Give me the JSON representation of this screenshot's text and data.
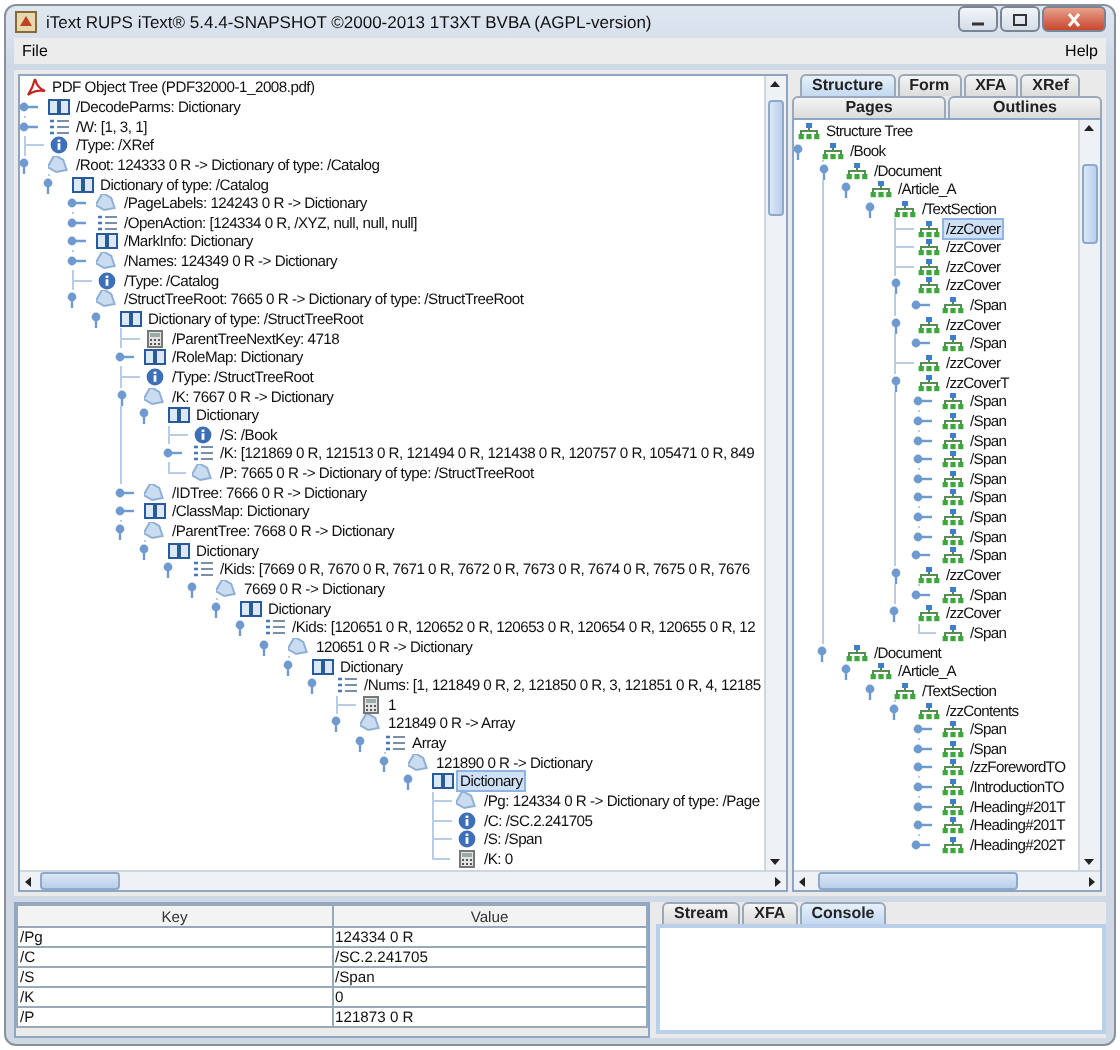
{
  "window": {
    "title": "iText RUPS iText® 5.4.4-SNAPSHOT ©2000-2013 1T3XT BVBA (AGPL-version)"
  },
  "menu": [
    {
      "label": "File"
    },
    {
      "label": "Help"
    }
  ],
  "object_tree": {
    "title": "PDF Object Tree (PDF32000-1_2008.pdf)",
    "children": [
      {
        "label": "/DecodeParms: Dictionary",
        "kind": "dict",
        "expanded": false,
        "selected": false
      },
      {
        "label": "/W: [1, 3, 1]",
        "kind": "array",
        "expanded": false,
        "selected": false
      },
      {
        "label": "/Type: /XRef",
        "kind": "info",
        "selected": false
      },
      {
        "label": "/Root: 124333 0 R -> Dictionary of type: /Catalog",
        "kind": "ref",
        "expanded": true,
        "selected": false,
        "children": [
          {
            "label": "Dictionary of type: /Catalog",
            "kind": "dict",
            "expanded": true,
            "selected": false,
            "children": [
              {
                "label": "/PageLabels: 124243 0 R -> Dictionary",
                "kind": "ref",
                "expanded": false,
                "selected": false
              },
              {
                "label": "/OpenAction: [124334 0 R, /XYZ, null, null, null]",
                "kind": "array",
                "expanded": false,
                "selected": false
              },
              {
                "label": "/MarkInfo: Dictionary",
                "kind": "dict",
                "expanded": false,
                "selected": false
              },
              {
                "label": "/Names: 124349 0 R -> Dictionary",
                "kind": "ref",
                "expanded": false,
                "selected": false
              },
              {
                "label": "/Type: /Catalog",
                "kind": "info",
                "selected": false
              },
              {
                "label": "/StructTreeRoot: 7665 0 R -> Dictionary of type: /StructTreeRoot",
                "kind": "ref",
                "expanded": true,
                "selected": false,
                "children": [
                  {
                    "label": "Dictionary of type: /StructTreeRoot",
                    "kind": "dict",
                    "expanded": true,
                    "selected": false,
                    "children": [
                      {
                        "label": "/ParentTreeNextKey: 4718",
                        "kind": "number",
                        "selected": false
                      },
                      {
                        "label": "/RoleMap: Dictionary",
                        "kind": "dict",
                        "expanded": false,
                        "selected": false
                      },
                      {
                        "label": "/Type: /StructTreeRoot",
                        "kind": "info",
                        "selected": false
                      },
                      {
                        "label": "/K: 7667 0 R -> Dictionary",
                        "kind": "ref",
                        "expanded": true,
                        "selected": false,
                        "children": [
                          {
                            "label": "Dictionary",
                            "kind": "dict",
                            "expanded": true,
                            "selected": false,
                            "children": [
                              {
                                "label": "/S: /Book",
                                "kind": "info",
                                "selected": false
                              },
                              {
                                "label": "/K: [121869 0 R, 121513 0 R, 121494 0 R, 121438 0 R, 120757 0 R, 105471 0 R, 849",
                                "kind": "array",
                                "expanded": false,
                                "selected": false
                              },
                              {
                                "label": "/P: 7665 0 R -> Dictionary of type: /StructTreeRoot",
                                "kind": "ref",
                                "selected": false
                              }
                            ]
                          }
                        ]
                      },
                      {
                        "label": "/IDTree: 7666 0 R -> Dictionary",
                        "kind": "ref",
                        "expanded": false,
                        "selected": false
                      },
                      {
                        "label": "/ClassMap: Dictionary",
                        "kind": "dict",
                        "expanded": false,
                        "selected": false
                      },
                      {
                        "label": "/ParentTree: 7668 0 R -> Dictionary",
                        "kind": "ref",
                        "expanded": true,
                        "selected": false,
                        "children": [
                          {
                            "label": "Dictionary",
                            "kind": "dict",
                            "expanded": true,
                            "selected": false,
                            "children": [
                              {
                                "label": "/Kids: [7669 0 R, 7670 0 R, 7671 0 R, 7672 0 R, 7673 0 R, 7674 0 R, 7675 0 R, 7676",
                                "kind": "array",
                                "expanded": true,
                                "selected": false,
                                "children": [
                                  {
                                    "label": "7669 0 R -> Dictionary",
                                    "kind": "ref",
                                    "expanded": true,
                                    "selected": false,
                                    "children": [
                                      {
                                        "label": "Dictionary",
                                        "kind": "dict",
                                        "expanded": true,
                                        "selected": false,
                                        "children": [
                                          {
                                            "label": "/Kids: [120651 0 R, 120652 0 R, 120653 0 R, 120654 0 R, 120655 0 R, 12",
                                            "kind": "array",
                                            "expanded": true,
                                            "selected": false,
                                            "children": [
                                              {
                                                "label": "120651 0 R -> Dictionary",
                                                "kind": "ref",
                                                "expanded": true,
                                                "selected": false,
                                                "children": [
                                                  {
                                                    "label": "Dictionary",
                                                    "kind": "dict",
                                                    "expanded": true,
                                                    "selected": false,
                                                    "children": [
                                                      {
                                                        "label": "/Nums: [1, 121849 0 R, 2, 121850 0 R, 3, 121851 0 R, 4, 12185",
                                                        "kind": "array",
                                                        "expanded": true,
                                                        "selected": false,
                                                        "children": [
                                                          {
                                                            "label": "1",
                                                            "kind": "number",
                                                            "selected": false
                                                          },
                                                          {
                                                            "label": "121849 0 R -> Array",
                                                            "kind": "ref",
                                                            "expanded": true,
                                                            "selected": false,
                                                            "children": [
                                                              {
                                                                "label": "Array",
                                                                "kind": "array",
                                                                "expanded": true,
                                                                "selected": false,
                                                                "children": [
                                                                  {
                                                                    "label": "121890 0 R -> Dictionary",
                                                                    "kind": "ref",
                                                                    "expanded": true,
                                                                    "selected": false,
                                                                    "children": [
                                                                      {
                                                                        "label": "Dictionary",
                                                                        "kind": "dict",
                                                                        "expanded": true,
                                                                        "selected": true,
                                                                        "children": [
                                                                          {
                                                                            "label": "/Pg: 124334 0 R -> Dictionary of type: /Page",
                                                                            "kind": "ref",
                                                                            "selected": false
                                                                          },
                                                                          {
                                                                            "label": "/C: /SC.2.241705",
                                                                            "kind": "info",
                                                                            "selected": false
                                                                          },
                                                                          {
                                                                            "label": "/S: /Span",
                                                                            "kind": "info",
                                                                            "selected": false
                                                                          },
                                                                          {
                                                                            "label": "/K: 0",
                                                                            "kind": "number",
                                                                            "selected": false
                                                                          }
                                                                        ]
                                                                      }
                                                                    ]
                                                                  }
                                                                ]
                                                              }
                                                            ]
                                                          }
                                                        ]
                                                      }
                                                    ]
                                                  }
                                                ]
                                              }
                                            ]
                                          }
                                        ]
                                      }
                                    ]
                                  }
                                ]
                              }
                            ]
                          }
                        ]
                      }
                    ]
                  }
                ]
              }
            ]
          }
        ]
      }
    ]
  },
  "structure_panel": {
    "tab_rows": [
      {
        "tabs": [
          {
            "label": "Structure",
            "selected": true
          },
          {
            "label": "Form",
            "selected": false
          },
          {
            "label": "XFA",
            "selected": false
          },
          {
            "label": "XRef",
            "selected": false
          }
        ]
      },
      {
        "tabs": [
          {
            "label": "Pages",
            "selected": false
          },
          {
            "label": "Outlines",
            "selected": false
          }
        ]
      }
    ],
    "tree": {
      "title": "Structure Tree",
      "children": [
        {
          "label": "/Book",
          "expanded": true,
          "selected": false,
          "children": [
            {
              "label": "/Document",
              "expanded": true,
              "selected": false,
              "children": [
                {
                  "label": "/Article_A",
                  "expanded": true,
                  "selected": false,
                  "children": [
                    {
                      "label": "/TextSection",
                      "expanded": true,
                      "selected": false,
                      "children": [
                        {
                          "label": "/zzCover",
                          "selected": true
                        },
                        {
                          "label": "/zzCover",
                          "selected": false
                        },
                        {
                          "label": "/zzCover",
                          "selected": false
                        },
                        {
                          "label": "/zzCover",
                          "expanded": true,
                          "selected": false,
                          "children": [
                            {
                              "label": "/Span",
                              "expanded": false,
                              "selected": false
                            }
                          ]
                        },
                        {
                          "label": "/zzCover",
                          "expanded": true,
                          "selected": false,
                          "children": [
                            {
                              "label": "/Span",
                              "expanded": false,
                              "selected": false
                            }
                          ]
                        },
                        {
                          "label": "/zzCover",
                          "selected": false
                        },
                        {
                          "label": "/zzCoverT",
                          "expanded": true,
                          "selected": false,
                          "children": [
                            {
                              "label": "/Span",
                              "expanded": false,
                              "selected": false
                            },
                            {
                              "label": "/Span",
                              "expanded": false,
                              "selected": false
                            },
                            {
                              "label": "/Span",
                              "expanded": false,
                              "selected": false
                            },
                            {
                              "label": "/Span",
                              "expanded": false,
                              "selected": false
                            },
                            {
                              "label": "/Span",
                              "expanded": false,
                              "selected": false
                            },
                            {
                              "label": "/Span",
                              "expanded": false,
                              "selected": false
                            },
                            {
                              "label": "/Span",
                              "expanded": false,
                              "selected": false
                            },
                            {
                              "label": "/Span",
                              "expanded": false,
                              "selected": false
                            },
                            {
                              "label": "/Span",
                              "expanded": false,
                              "selected": false
                            }
                          ]
                        },
                        {
                          "label": "/zzCover",
                          "expanded": true,
                          "selected": false,
                          "children": [
                            {
                              "label": "/Span",
                              "expanded": false,
                              "selected": false
                            }
                          ]
                        },
                        {
                          "label": "/zzCover",
                          "expanded": true,
                          "selected": false,
                          "children": [
                            {
                              "label": "/Span",
                              "selected": false
                            }
                          ]
                        }
                      ]
                    }
                  ]
                }
              ]
            },
            {
              "label": "/Document",
              "expanded": true,
              "selected": false,
              "children": [
                {
                  "label": "/Article_A",
                  "expanded": true,
                  "selected": false,
                  "children": [
                    {
                      "label": "/TextSection",
                      "expanded": true,
                      "selected": false,
                      "children": [
                        {
                          "label": "/zzContents",
                          "expanded": true,
                          "selected": false,
                          "children": [
                            {
                              "label": "/Span",
                              "expanded": false,
                              "selected": false
                            },
                            {
                              "label": "/Span",
                              "expanded": false,
                              "selected": false
                            },
                            {
                              "label": "/zzForewordTO",
                              "expanded": false,
                              "selected": false
                            },
                            {
                              "label": "/IntroductionTO",
                              "expanded": false,
                              "selected": false
                            },
                            {
                              "label": "/Heading#201T",
                              "expanded": false,
                              "selected": false
                            },
                            {
                              "label": "/Heading#201T",
                              "expanded": false,
                              "selected": false
                            },
                            {
                              "label": "/Heading#202T",
                              "expanded": false,
                              "selected": false
                            }
                          ]
                        }
                      ]
                    }
                  ]
                }
              ]
            }
          ]
        }
      ]
    }
  },
  "properties_table": {
    "columns": [
      "Key",
      "Value"
    ],
    "rows": [
      [
        "/Pg",
        "124334 0 R"
      ],
      [
        "/C",
        "/SC.2.241705"
      ],
      [
        "/S",
        "/Span"
      ],
      [
        "/K",
        "0"
      ],
      [
        "/P",
        "121873 0 R"
      ]
    ]
  },
  "output_panel": {
    "tabs": [
      {
        "label": "Stream",
        "selected": false
      },
      {
        "label": "XFA",
        "selected": false
      },
      {
        "label": "Console",
        "selected": true
      }
    ]
  }
}
